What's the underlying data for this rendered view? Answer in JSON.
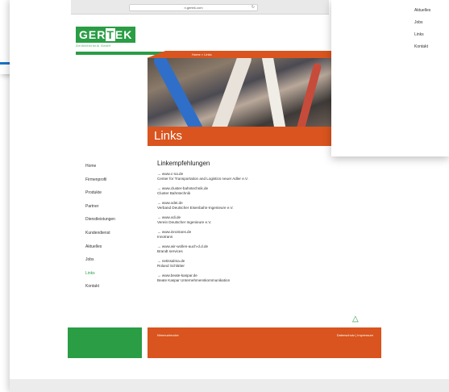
{
  "browser": {
    "url": "n.gertek.com"
  },
  "logo": {
    "part1": "GER",
    "part2": "T",
    "part3": "EK",
    "subtitle": "Gerätetechnik GmbH"
  },
  "breadcrumb": "Home  >  Links",
  "page_title": "Links",
  "right_menu": [
    "Aktuelles",
    "Jobs",
    "Links",
    "Kontakt"
  ],
  "sidebar": {
    "items": [
      "Home",
      "Firmenprofil",
      "Produkte",
      "Partner",
      "Dienstleistungen",
      "Kundendienst",
      "Aktuelles",
      "Jobs",
      "Links",
      "Kontakt"
    ],
    "active_index": 8
  },
  "content": {
    "heading": "Linkempfehlungen",
    "links": [
      {
        "url": "→ www.c-na.de",
        "desc": "Center for Transportation and Logistics neuer Adler e.V."
      },
      {
        "url": "→ www.cluster-bahntechnik.de",
        "desc": "Cluster Bahntechnik"
      },
      {
        "url": "→ www.vdei.de",
        "desc": "Verband Deutscher Eisenbahn-Ingenieure e.V."
      },
      {
        "url": "→ www.vdi.de",
        "desc": "Verein Deutscher Ingenieure e.V."
      },
      {
        "url": "→ www.innotrans.de",
        "desc": "Innotrans"
      },
      {
        "url": "→ www.wir-wollen-auch-d.d.de",
        "desc": "Brandt services"
      },
      {
        "url": "→ netissalma.de",
        "desc": "Roland Schlütter"
      },
      {
        "url": "→ www.beate-kaspar.de",
        "desc": "Beate Kaspar Unternehmenskommunikation"
      }
    ]
  },
  "footer": {
    "left": "Nimmuzbrucke",
    "right": "Datenschutz | Impressum"
  },
  "colors": {
    "brand_green": "#2a9d45",
    "brand_orange": "#d9541e"
  }
}
